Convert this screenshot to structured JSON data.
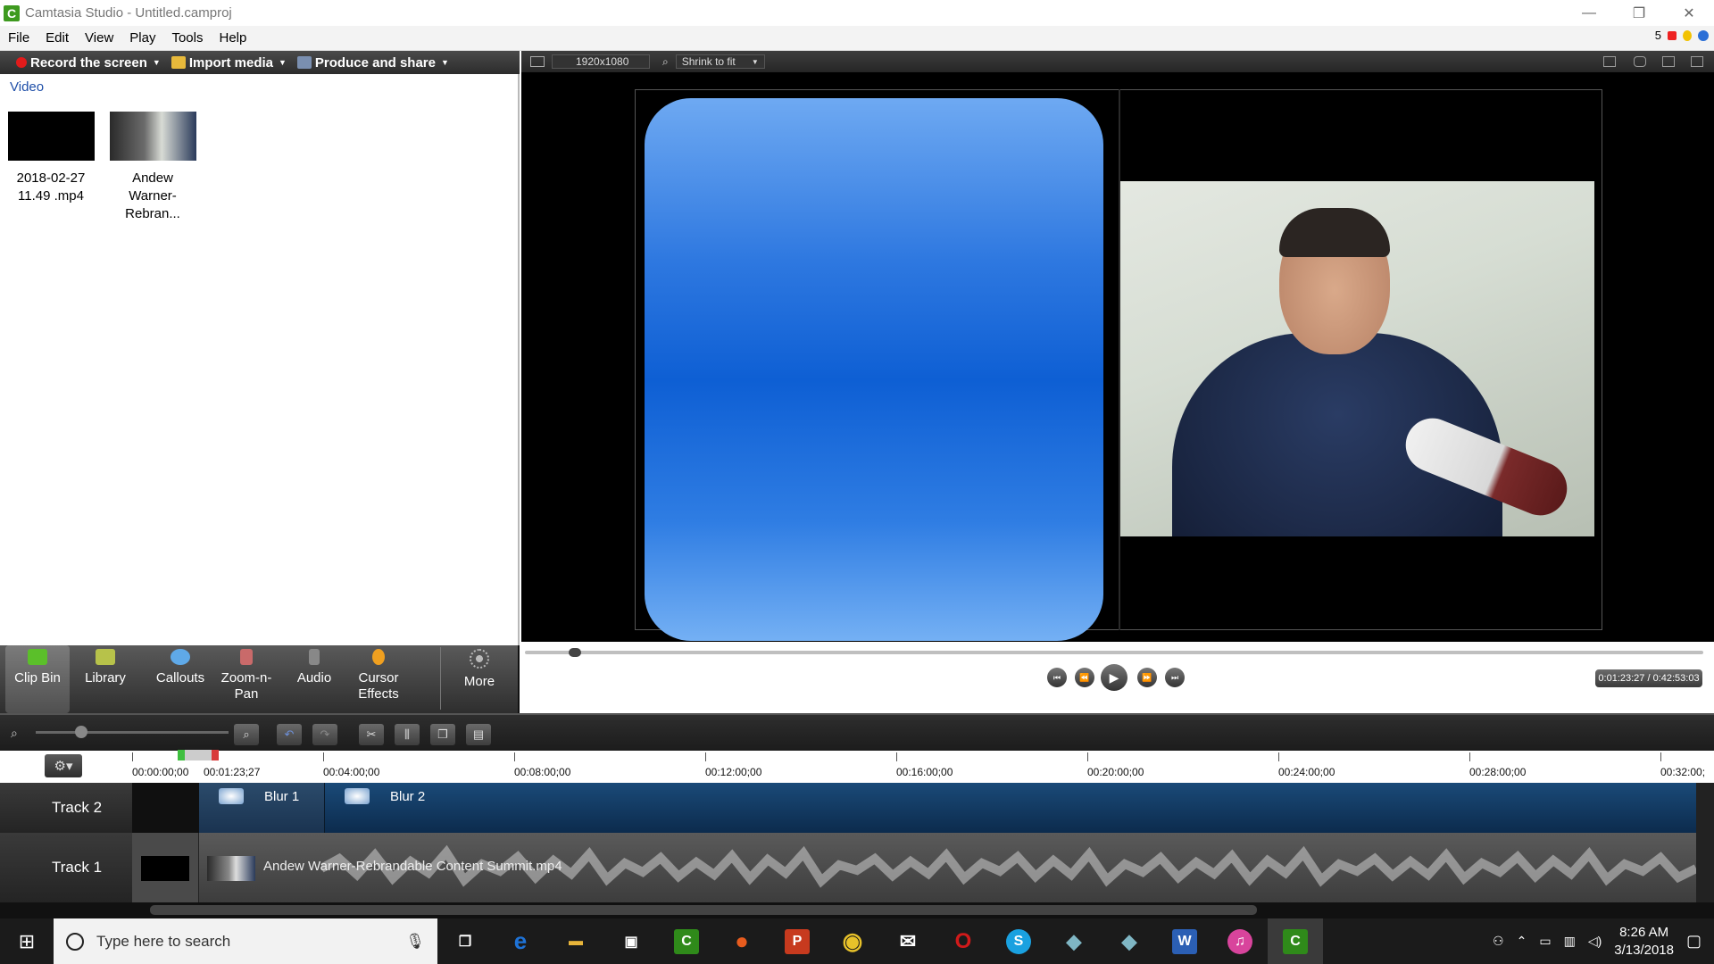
{
  "window": {
    "title": "Camtasia Studio - Untitled.camproj",
    "app_icon_letter": "C",
    "minimize": "—",
    "restore": "❐",
    "close": "✕"
  },
  "menu": [
    "File",
    "Edit",
    "View",
    "Play",
    "Tools",
    "Help"
  ],
  "menu_right": {
    "count": "5"
  },
  "toolbar": {
    "record": "Record the screen",
    "import": "Import media",
    "produce": "Produce and share"
  },
  "clip_bin": {
    "header": "Video",
    "clips": [
      {
        "line1": "2018-02-27",
        "line2": "11.49 .mp4"
      },
      {
        "line1": "Andew",
        "line2": "Warner-Rebran..."
      }
    ]
  },
  "task_tabs": [
    {
      "label": "Clip Bin",
      "color": "#5bbf2a"
    },
    {
      "label": "Library",
      "color": "#b7c24a"
    },
    {
      "label": "Callouts",
      "color": "#5fa9e8"
    },
    {
      "label": "Zoom-n-\nPan",
      "color": "#c96a6a"
    },
    {
      "label": "Audio",
      "color": "#888888"
    },
    {
      "label": "Cursor\nEffects",
      "color": "#f0a020"
    },
    {
      "label": "More",
      "color": "#bbbbbb"
    }
  ],
  "preview": {
    "dimensions": "1920x1080",
    "zoom": "Shrink to fit",
    "time": "0:01:23:27 / 0:42:53:03"
  },
  "timeline": {
    "ticks": [
      "00:00:00;00",
      "00:01:23;27",
      "00:04:00;00",
      "00:08:00;00",
      "00:12:00;00",
      "00:16:00;00",
      "00:20:00;00",
      "00:24:00;00",
      "00:28:00;00",
      "00:32:00;"
    ],
    "tracks": [
      {
        "name": "Track 2",
        "clips": [
          "Blur 1",
          "Blur 2"
        ]
      },
      {
        "name": "Track 1",
        "clip": "Andew Warner-Rebrandable Content Summit.mp4"
      }
    ]
  },
  "taskbar": {
    "search_placeholder": "Type here to search",
    "time": "8:26 AM",
    "date": "3/13/2018",
    "apps": [
      {
        "name": "task-view",
        "letter": "❐",
        "color": "#1b1b1b"
      },
      {
        "name": "edge",
        "letter": "e",
        "color": "#1e73d8"
      },
      {
        "name": "file-explorer",
        "letter": "▬",
        "color": "#e8b53a"
      },
      {
        "name": "store",
        "letter": "▣",
        "color": "#1b1b1b"
      },
      {
        "name": "camtasia-recorder",
        "letter": "C",
        "color": "#2f8a1a"
      },
      {
        "name": "firefox",
        "letter": "●",
        "color": "#e85c1e"
      },
      {
        "name": "powerpoint",
        "letter": "P",
        "color": "#c73a1e"
      },
      {
        "name": "chrome",
        "letter": "◉",
        "color": "#2c9a44"
      },
      {
        "name": "mail",
        "letter": "✉",
        "color": "#1b1b1b"
      },
      {
        "name": "opera",
        "letter": "O",
        "color": "#d11a1a"
      },
      {
        "name": "skype",
        "letter": "S",
        "color": "#1aa1e0"
      },
      {
        "name": "app-1",
        "letter": "◆",
        "color": "#7fb6c4"
      },
      {
        "name": "app-2",
        "letter": "◆",
        "color": "#7fb6c4"
      },
      {
        "name": "word",
        "letter": "W",
        "color": "#2b5fb4"
      },
      {
        "name": "itunes",
        "letter": "♫",
        "color": "#d8449c"
      },
      {
        "name": "camtasia-studio",
        "letter": "C",
        "color": "#2f8a1a"
      }
    ]
  }
}
